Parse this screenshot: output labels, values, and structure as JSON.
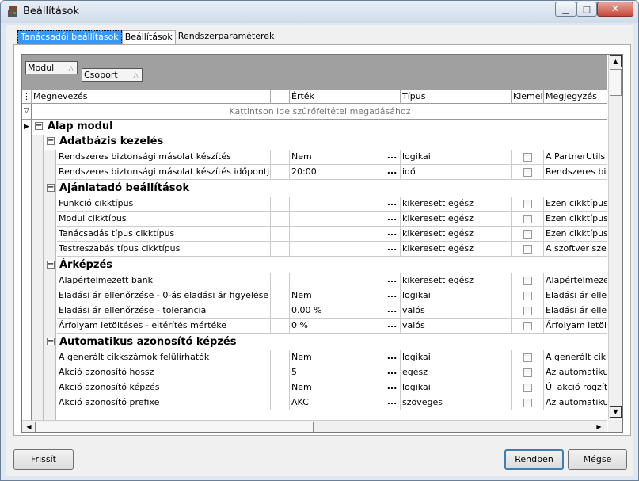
{
  "window": {
    "title": "Beállítások"
  },
  "tabs": [
    "Tanácsadói beállítások",
    "Beállítások",
    "Rendszerparaméterek"
  ],
  "group_by": [
    "Modul",
    "Csoport"
  ],
  "columns": [
    "Megnevezés",
    "Érték",
    "Típus",
    "Kiemelt",
    "Megjegyzés"
  ],
  "filter_hint": "Kattintson ide szűrőfeltétel megadásához",
  "top_group": "Alap modul",
  "groups": [
    {
      "name": "Adatbázis kezelés",
      "rows": [
        {
          "name": "Rendszeres biztonsági másolat készítés",
          "value": "Nem",
          "type": "logikai",
          "note": "A PartnerUtils m"
        },
        {
          "name": "Rendszeres biztonsági másolat készítés időpontja",
          "value": "20:00",
          "type": "idő",
          "note": "Rendszeres bizt"
        }
      ]
    },
    {
      "name": "Ajánlatadó beállítások",
      "rows": [
        {
          "name": "Funkció cikktípus",
          "value": "",
          "type": "kikeresett egész",
          "note": "Ezen cikktípusú"
        },
        {
          "name": "Modul cikktípus",
          "value": "",
          "type": "kikeresett egész",
          "note": "Ezen cikktípusú"
        },
        {
          "name": "Tanácsadás típus cikktípus",
          "value": "",
          "type": "kikeresett egész",
          "note": "Ezen cikktípusú"
        },
        {
          "name": "Testreszabás típus cikktípus",
          "value": "",
          "type": "kikeresett egész",
          "note": "A szoftver szerz"
        }
      ]
    },
    {
      "name": "Árképzés",
      "rows": [
        {
          "name": "Alapértelmezett bank",
          "value": "",
          "type": "kikeresett egész",
          "note": "Alapértelmezett"
        },
        {
          "name": "Eladási ár ellenőrzése - 0-ás eladási ár figyelése",
          "value": "Nem",
          "type": "logikai",
          "note": "Eladási ár ellenő"
        },
        {
          "name": "Eladási ár ellenőrzése - tolerancia",
          "value": "0.00 %",
          "type": "valós",
          "note": "Eladási ár ellenő"
        },
        {
          "name": "Árfolyam letöltéses - eltérítés mértéke",
          "value": "0 %",
          "type": "valós",
          "note": "Árfolyam letölté"
        }
      ]
    },
    {
      "name": "Automatikus azonosító képzés",
      "rows": [
        {
          "name": "A generált cikkszámok felülírhatók",
          "value": "Nem",
          "type": "logikai",
          "note": "A generált cikks"
        },
        {
          "name": "Akció azonosító hossz",
          "value": "5",
          "type": "egész",
          "note": "Az automatikusa"
        },
        {
          "name": "Akció azonosító képzés",
          "value": "Nem",
          "type": "logikai",
          "note": "Új akció rögzíté"
        },
        {
          "name": "Akció azonosító prefixe",
          "value": "AKC",
          "type": "szöveges",
          "note": "Az automatikusa"
        }
      ]
    }
  ],
  "buttons": {
    "refresh": "Frissít",
    "ok": "Rendben",
    "cancel": "Mégse"
  }
}
